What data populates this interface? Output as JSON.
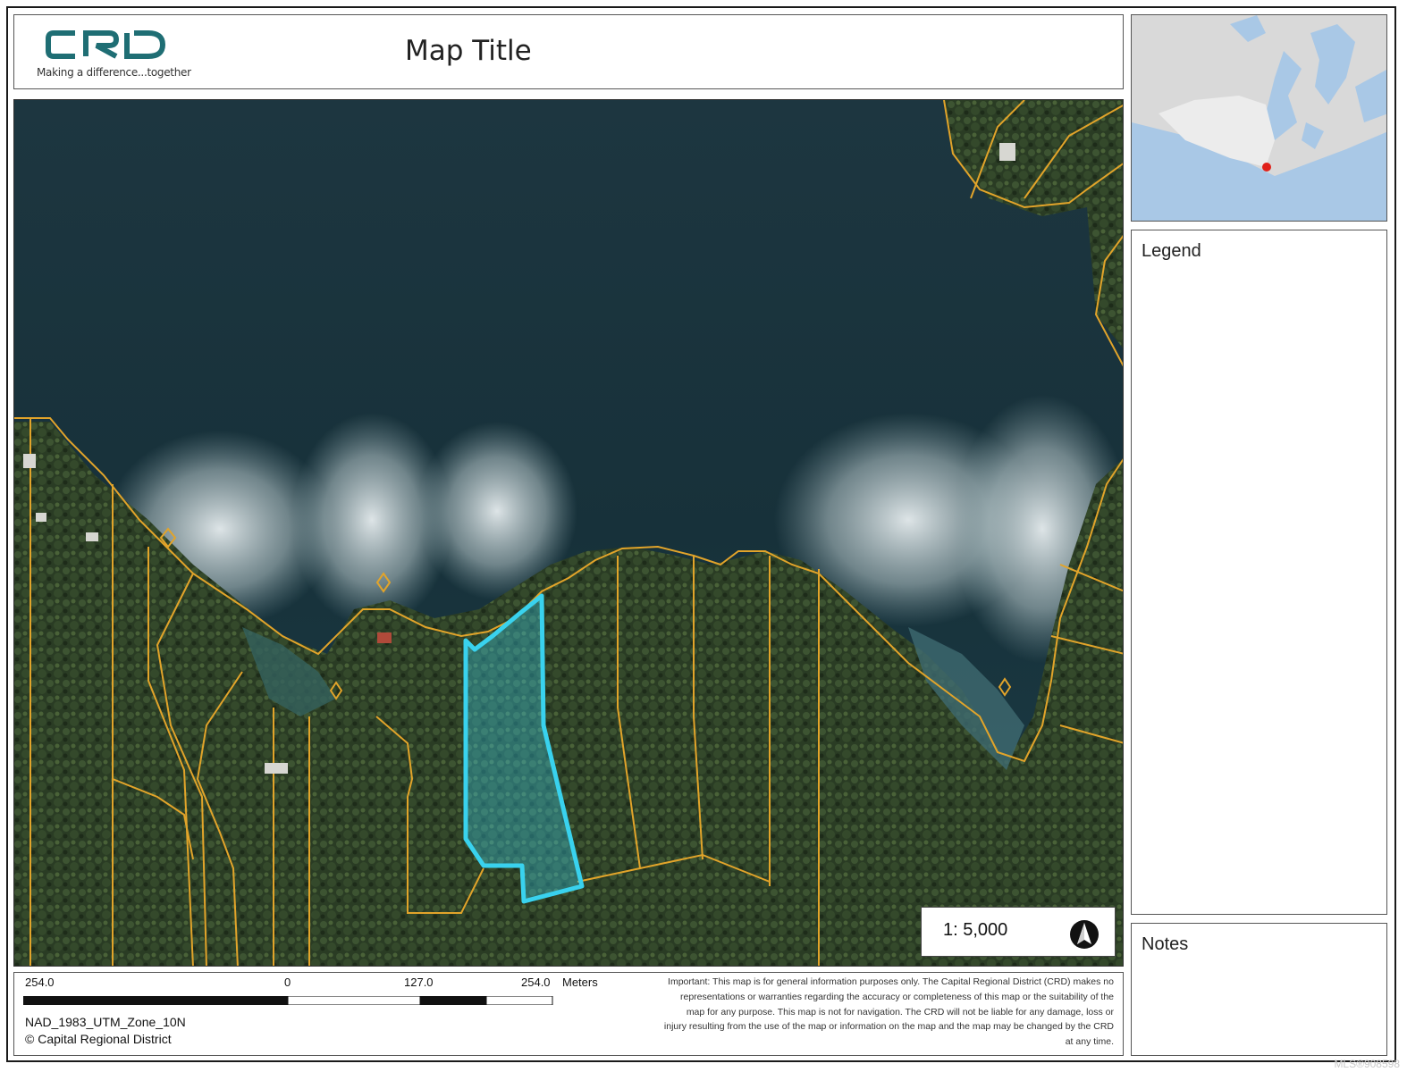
{
  "header": {
    "logo_text": "CRD",
    "logo_tagline": "Making a difference...together",
    "map_title": "Map Title"
  },
  "map": {
    "scale_ratio": "1: 5,000",
    "imagery": "aerial-satellite",
    "highlighted_parcel_color": "#39d2ee",
    "parcel_line_color": "#e2a42a",
    "north_arrow": "north-arrow-icon"
  },
  "inset_map": {
    "location_marker_color": "#e0201a",
    "land_color": "#d9d9d9",
    "water_color": "#a9c8e6"
  },
  "legend": {
    "title": "Legend"
  },
  "notes": {
    "title": "Notes"
  },
  "scale_bar": {
    "labels": [
      "254.0",
      "0",
      "127.0",
      "254.0"
    ],
    "unit": "Meters"
  },
  "footer": {
    "projection": "NAD_1983_UTM_Zone_10N",
    "copyright": "© Capital Regional District",
    "disclaimer": "Important: This map is for general information purposes only. The Capital Regional District (CRD) makes no representations or warranties regarding the accuracy or completeness of this map or the suitability of the map for any purpose. This map is not for navigation. The CRD will not be liable for any damage, loss or injury resulting from the use of the map or information on the map and the map may be changed by the CRD at any time.",
    "watermark": "MLS®908598"
  }
}
